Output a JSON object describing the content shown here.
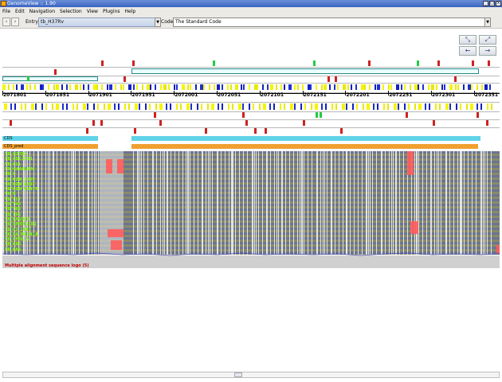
{
  "window": {
    "title": "GenomeView :: 1.90"
  },
  "menu": [
    "File",
    "Edit",
    "Navigation",
    "Selection",
    "View",
    "Plugins",
    "Help"
  ],
  "toolbar": {
    "entry_label": "Entry:",
    "entry_value": "tb_H37Rv",
    "code_label": "Code:",
    "code_value": "The Standard Code"
  },
  "ruler": {
    "labels": [
      "2071801",
      "2071851",
      "2071901",
      "2071951",
      "2072001",
      "2072051",
      "2072101",
      "2072151",
      "2072201",
      "2072251",
      "2072301",
      "2072351"
    ]
  },
  "tracks": {
    "cds": "CDS",
    "cds_pred": "CDS_pred"
  },
  "alignment": {
    "names": [
      "TB_H37Rv",
      "TB_CDC1551",
      "TB_F11",
      "TB_HAARLEM",
      "TB_C",
      "TB_KZN_1435",
      "TB_KZN_4207",
      "TB_KZN_V2475",
      "TB_R",
      "TB_T17",
      "TB_T46",
      "TB_T85",
      "TB_T92",
      "TB_EAS054",
      "TB_GM041182",
      "TB_02_1987",
      "TB_94_M4241A",
      "TB_CPHL_A",
      "TB_K85",
      "TB_EAS"
    ],
    "logo_label": "Multiple alignment sequence logo (5)"
  },
  "colors": {
    "stop": "#cc2222",
    "start": "#22cc44",
    "cds": "#5fd3e8",
    "cds_pred": "#f0a030",
    "alignment_name": "#7fff00"
  }
}
